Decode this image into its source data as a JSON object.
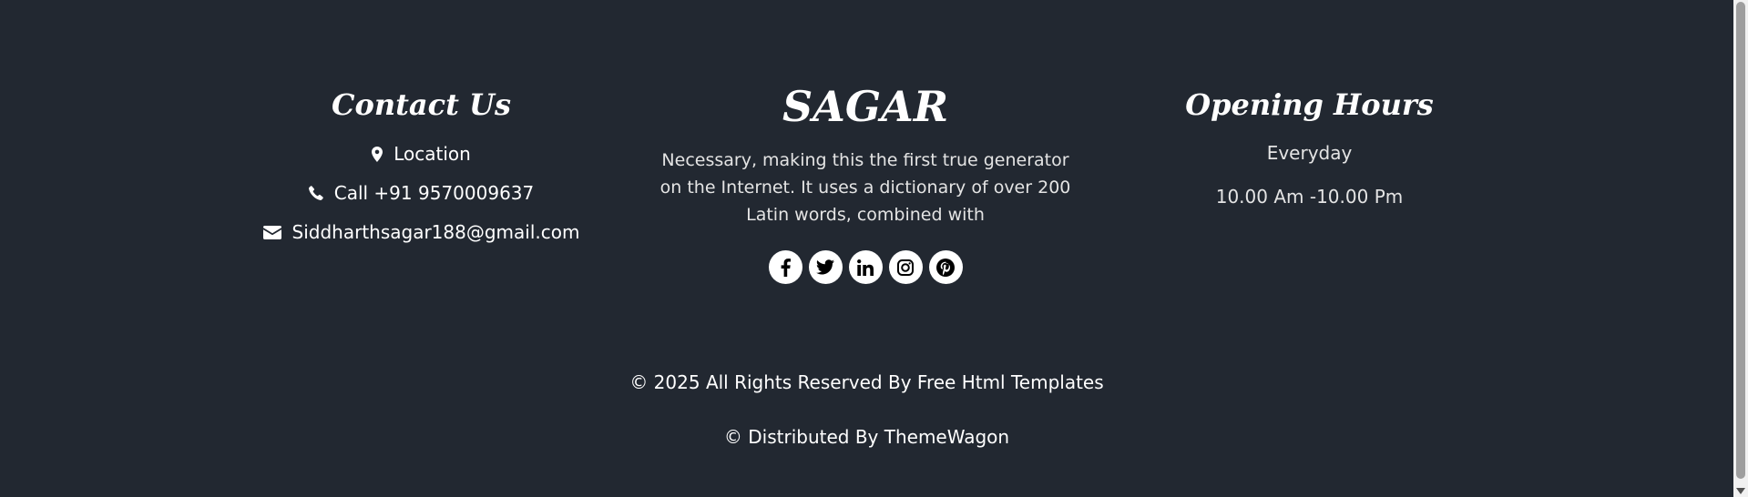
{
  "contact": {
    "heading": "Contact Us",
    "location": "Location",
    "phone": "Call +91 9570009637",
    "email": "Siddharthsagar188@gmail.com"
  },
  "brand": {
    "title": "SAGAR",
    "description": "Necessary, making this the first true generator on the Internet. It uses a dictionary of over 200 Latin words, combined with",
    "social_icons": [
      "facebook-icon",
      "twitter-icon",
      "linkedin-icon",
      "instagram-icon",
      "pinterest-icon"
    ]
  },
  "hours": {
    "heading": "Opening Hours",
    "days": "Everyday",
    "time": "10.00 Am -10.00 Pm"
  },
  "footer": {
    "copyright": "© 2025 All Rights Reserved By Free Html Templates",
    "distributed": "© Distributed By ThemeWagon"
  },
  "colors": {
    "background": "#222831",
    "text": "#ffffff",
    "icon_bg": "#ffffff",
    "icon_fg": "#000000"
  }
}
